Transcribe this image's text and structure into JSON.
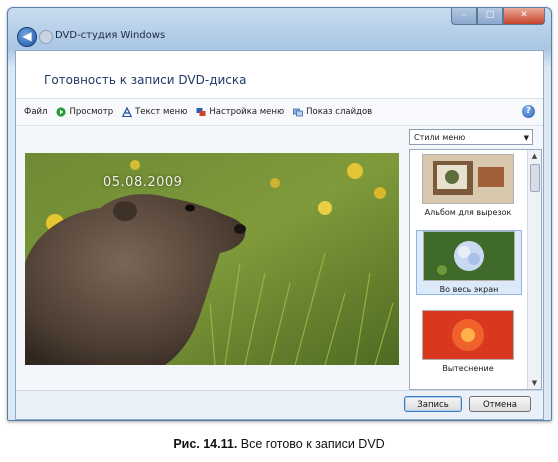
{
  "window": {
    "title": "DVD-студия Windows",
    "heading": "Готовность к записи DVD-диска"
  },
  "toolbar": {
    "items": [
      {
        "label": "Файл",
        "icon": "none"
      },
      {
        "label": "Просмотр",
        "icon": "play-icon"
      },
      {
        "label": "Текст меню",
        "icon": "text-icon"
      },
      {
        "label": "Настройка меню",
        "icon": "customize-icon"
      },
      {
        "label": "Показ слайдов",
        "icon": "slideshow-icon"
      }
    ],
    "help_glyph": "?"
  },
  "preview": {
    "date_text": "05.08.2009"
  },
  "styles_dropdown": {
    "selected": "Стили меню"
  },
  "menu_styles": [
    {
      "label": "Альбом для вырезок",
      "selected": false
    },
    {
      "label": "Во весь экран",
      "selected": true
    },
    {
      "label": "Вытеснение",
      "selected": false
    }
  ],
  "buttons": {
    "burn": "Запись",
    "cancel": "Отмена"
  },
  "caption": {
    "bold": "Рис. 14.11.",
    "text": " Все готово к записи DVD"
  },
  "colors": {
    "accent": "#1f3a66",
    "window_frame": "#a9c6e4",
    "selection": "#dbe9f9"
  }
}
